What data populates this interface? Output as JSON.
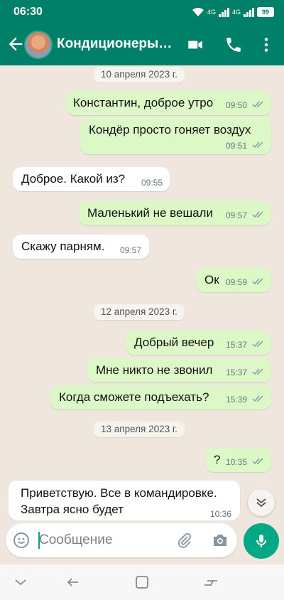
{
  "status": {
    "time": "06:30",
    "net1": "4G",
    "net2": "4G",
    "battery": "99"
  },
  "header": {
    "title": "Кондиционеры Гав...",
    "back_icon": "arrow-left-icon",
    "video_icon": "video-call-icon",
    "call_icon": "phone-icon",
    "menu_icon": "more-vert-icon"
  },
  "dates": [
    "10 апреля 2023 г.",
    "12 апреля 2023 г.",
    "13 апреля 2023 г."
  ],
  "messages": [
    {
      "dir": "out",
      "text": "Константин, доброе утро",
      "time": "09:50"
    },
    {
      "dir": "out",
      "text": "Кондёр просто гоняет воздух",
      "time": "09:51"
    },
    {
      "dir": "in",
      "text": "Доброе. Какой из?",
      "time": "09:55"
    },
    {
      "dir": "out",
      "text": "Маленький не вешали",
      "time": "09:57"
    },
    {
      "dir": "in",
      "text": "Скажу парням.",
      "time": "09:57"
    },
    {
      "dir": "out",
      "text": "Ок",
      "time": "09:59"
    },
    {
      "dir": "out",
      "text": "Добрый вечер",
      "time": "15:37"
    },
    {
      "dir": "out",
      "text": "Мне никто не звонил",
      "time": "15:37"
    },
    {
      "dir": "out",
      "text": "Когда сможете подъехать?",
      "time": "15:39"
    },
    {
      "dir": "out",
      "text": "?",
      "time": "10:35"
    },
    {
      "dir": "in",
      "line1": "Приветствую. Все в командировке.",
      "line2": "Завтра ясно будет",
      "time": "10:36"
    }
  ],
  "composer": {
    "placeholder": "Сообщение",
    "emoji_icon": "emoji-icon",
    "attach_icon": "paperclip-icon",
    "camera_icon": "camera-icon",
    "mic_icon": "microphone-icon"
  },
  "colors": {
    "header": "#008069",
    "outgoing": "#dcf8c6",
    "incoming": "#ffffff",
    "ticks": "#8696a0",
    "accent": "#00a884"
  }
}
